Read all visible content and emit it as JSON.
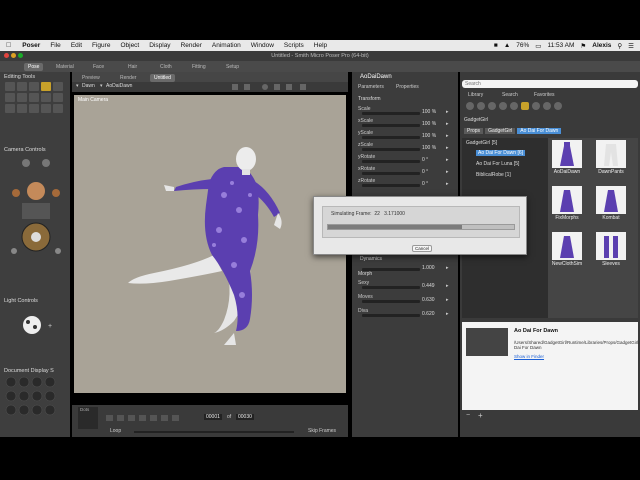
{
  "menubar": {
    "app": "Poser",
    "items": [
      "File",
      "Edit",
      "Figure",
      "Object",
      "Display",
      "Render",
      "Animation",
      "Window",
      "Scripts",
      "Help"
    ],
    "battery": "76%",
    "clock": "11:53 AM",
    "user": "Alexis"
  },
  "window": {
    "title": "Untitled - Smith Micro Poser Pro (64-bit)"
  },
  "rooms": [
    "Pose",
    "Material",
    "Face",
    "Hair",
    "Cloth",
    "Fitting",
    "Setup"
  ],
  "tools": {
    "title": "Editing Tools"
  },
  "viewport": {
    "tabs": [
      "Preview",
      "Render",
      "Untitled"
    ],
    "camera_select": "Dawn",
    "actor_select": "AoDaiDawn",
    "camera_label": "Main Camera"
  },
  "camera_controls": {
    "title": "Camera Controls"
  },
  "light_controls": {
    "title": "Light Controls"
  },
  "document_display": {
    "title": "Document Display S"
  },
  "timeline": {
    "label": "Loop",
    "frame": "00001",
    "of": "of",
    "total": "00030",
    "skip_label": "Skip Frames",
    "dots_label": "Dots"
  },
  "params": {
    "actor": "AoDaiDawn",
    "tabs": [
      "Parameters",
      "Properties"
    ],
    "section_transform": "Transform",
    "transform": [
      {
        "label": "Scale",
        "value": "100 %"
      },
      {
        "label": "xScale",
        "value": "100 %"
      },
      {
        "label": "yScale",
        "value": "100 %"
      },
      {
        "label": "zScale",
        "value": "100 %"
      },
      {
        "label": "yRotate",
        "value": "0 °"
      },
      {
        "label": "xRotate",
        "value": "0 °"
      },
      {
        "label": "zRotate",
        "value": "0 °"
      }
    ],
    "section_dynamics": "Dynamics",
    "dynamics_value": "1.000",
    "section_morph": "Morph",
    "morph": [
      {
        "label": "Sexy",
        "value": "0.449"
      },
      {
        "label": "Moves",
        "value": "0.630"
      },
      {
        "label": "Diva",
        "value": "0.620"
      }
    ]
  },
  "library": {
    "search_placeholder": "Search",
    "tabs": [
      "Library",
      "Search",
      "Favorites"
    ],
    "runtime": "GadgetGirl",
    "breadcrumb": [
      "Props",
      "GadgetGirl",
      "Ao Dai For Dawn"
    ],
    "tree": [
      {
        "label": "GadgetGirl",
        "count": "[5]"
      },
      {
        "label": "Ao Dai For Dawn",
        "count": "[6]"
      },
      {
        "label": "Ao Dai For Luna",
        "count": "[5]"
      },
      {
        "label": "BiblicalRobe",
        "count": "[1]"
      }
    ],
    "thumbs": [
      "AoDaiDawn",
      "DawnPants",
      "FixMorphs",
      "Kombat",
      "NewClothSim",
      "Sleeves"
    ],
    "info_title": "Ao Dai For Dawn",
    "info_path": "/Users/Shared/GadgetGirl/Runtime/Libraries/Props/GadgetGirl/Ao Dai For Dawn",
    "info_link": "Show in Finder"
  },
  "dialog": {
    "label": "Simulating Frame:",
    "frame": "22",
    "time": "3.171000",
    "progress": 0.72,
    "cancel": "Cancel"
  },
  "colors": {
    "accent": "#c8a12a",
    "selection": "#4a8fd6",
    "viewport_bg": "#a9a397",
    "dress": "#5b3fb0"
  }
}
